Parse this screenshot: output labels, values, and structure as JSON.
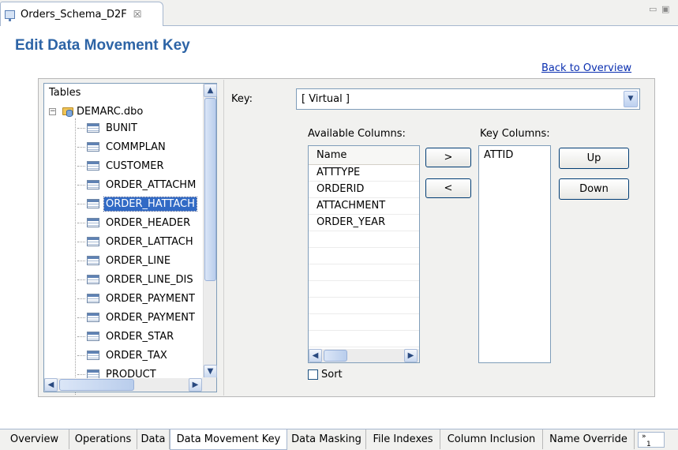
{
  "editor_tab": {
    "title": "Orders_Schema_D2F",
    "close_glyph": "☒"
  },
  "window_controls": {
    "minimize": "▭",
    "maximize": "▣"
  },
  "page_title": "Edit Data Movement Key",
  "back_link": "Back to Overview",
  "tree": {
    "header": "Tables",
    "root": "DEMARC.dbo",
    "expander": "−",
    "items": [
      {
        "label": "BUNIT",
        "selected": false
      },
      {
        "label": "COMMPLAN",
        "selected": false
      },
      {
        "label": "CUSTOMER",
        "selected": false
      },
      {
        "label": "ORDER_ATTACHM",
        "selected": false
      },
      {
        "label": "ORDER_HATTACH",
        "selected": true
      },
      {
        "label": "ORDER_HEADER",
        "selected": false
      },
      {
        "label": "ORDER_LATTACH",
        "selected": false
      },
      {
        "label": "ORDER_LINE",
        "selected": false
      },
      {
        "label": "ORDER_LINE_DIS",
        "selected": false
      },
      {
        "label": "ORDER_PAYMENT",
        "selected": false
      },
      {
        "label": "ORDER_PAYMENT",
        "selected": false
      },
      {
        "label": "ORDER_STAR",
        "selected": false
      },
      {
        "label": "ORDER_TAX",
        "selected": false
      },
      {
        "label": "PRODUCT",
        "selected": false
      }
    ]
  },
  "key": {
    "label": "Key:",
    "value": "[ Virtual ]"
  },
  "available": {
    "label": "Available Columns:",
    "header": "Name",
    "rows": [
      "ATTTYPE",
      "ORDERID",
      "ATTACHMENT",
      "ORDER_YEAR"
    ]
  },
  "key_columns": {
    "label": "Key Columns:",
    "items": [
      "ATTID"
    ]
  },
  "buttons": {
    "add": ">",
    "remove": "<",
    "up": "Up",
    "down": "Down"
  },
  "sort_label": "Sort",
  "bottom_tabs": [
    "Overview",
    "Operations",
    "Data",
    "Data Movement Key",
    "Data Masking",
    "File Indexes",
    "Column Inclusion",
    "Name Override"
  ],
  "active_tab": "Data Movement Key",
  "more_tabs": {
    "chevron": "»",
    "count": "1"
  }
}
